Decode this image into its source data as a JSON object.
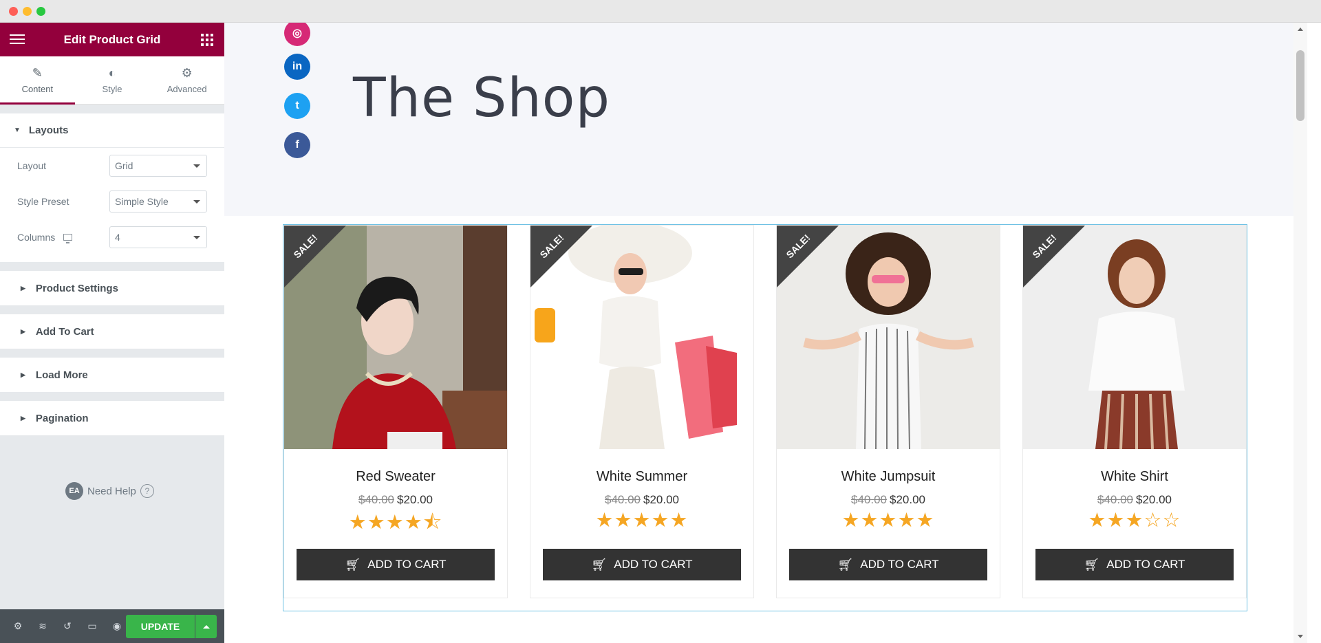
{
  "window": {
    "traffic_lights": [
      "close",
      "minimize",
      "maximize"
    ]
  },
  "sidebar": {
    "title": "Edit Product Grid",
    "tabs": [
      {
        "label": "Content",
        "icon": "pencil-icon"
      },
      {
        "label": "Style",
        "icon": "half-circle-icon"
      },
      {
        "label": "Advanced",
        "icon": "gear-icon"
      }
    ],
    "layouts_section": {
      "title": "Layouts",
      "controls": [
        {
          "label": "Layout",
          "value": "Grid"
        },
        {
          "label": "Style Preset",
          "value": "Simple Style"
        },
        {
          "label": "Columns",
          "value": "4"
        }
      ]
    },
    "collapsed_sections": [
      "Product Settings",
      "Add To Cart",
      "Load More",
      "Pagination"
    ],
    "help": {
      "badge": "EA",
      "label": "Need Help",
      "q": "?"
    },
    "footer": {
      "update_label": "UPDATE"
    },
    "accent_color": "#93003c",
    "update_color": "#39b54a"
  },
  "hero": {
    "title": "The Shop",
    "social_icons": [
      "instagram-icon",
      "linkedin-icon",
      "twitter-icon",
      "facebook-icon"
    ],
    "social_glyphs": [
      "◎",
      "in",
      "t",
      "f"
    ],
    "social_colors": [
      "#d62976",
      "#0a66c2",
      "#1da1f2",
      "#3b5998"
    ]
  },
  "products": [
    {
      "name": "Red Sweater",
      "old_price": "$40.00",
      "price": "$20.00",
      "rating": 4.5,
      "badge": "SALE!",
      "button": "ADD TO CART"
    },
    {
      "name": "White Summer",
      "old_price": "$40.00",
      "price": "$20.00",
      "rating": 5,
      "badge": "SALE!",
      "button": "ADD TO CART"
    },
    {
      "name": "White Jumpsuit",
      "old_price": "$40.00",
      "price": "$20.00",
      "rating": 5,
      "badge": "SALE!",
      "button": "ADD TO CART"
    },
    {
      "name": "White Shirt",
      "old_price": "$40.00",
      "price": "$20.00",
      "rating": 3,
      "badge": "SALE!",
      "button": "ADD TO CART"
    }
  ]
}
